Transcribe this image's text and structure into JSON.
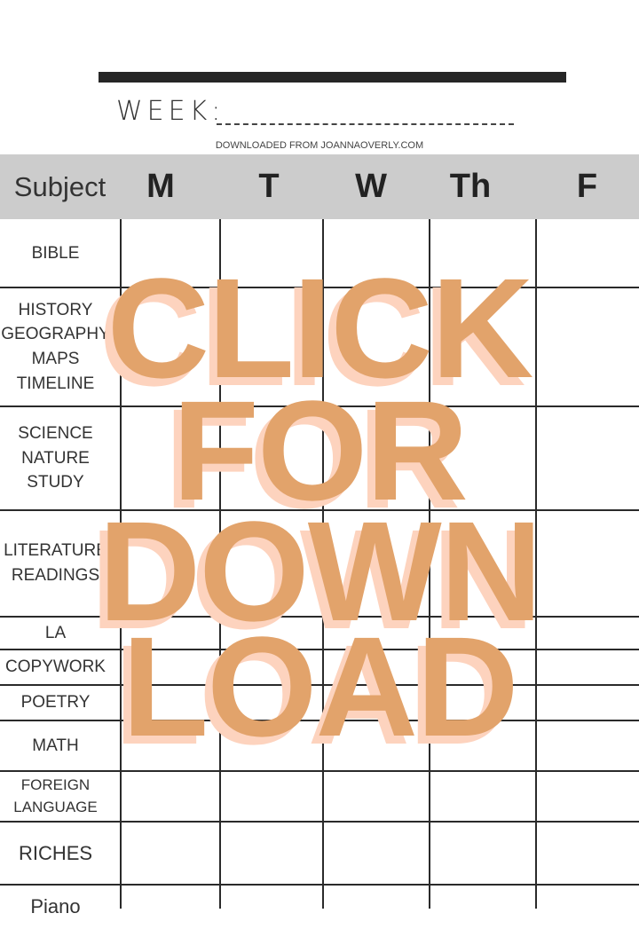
{
  "header": {
    "week_label": "WEEK:",
    "credit": "DOWNLOADED FROM JOANNAOVERLY.COM"
  },
  "table": {
    "columns": [
      "Subject",
      "M",
      "T",
      "W",
      "Th",
      "F"
    ],
    "rows": [
      {
        "label": [
          "BIBLE"
        ]
      },
      {
        "label": [
          "HISTORY",
          "GEOGRAPHY",
          "MAPS",
          "TIMELINE"
        ]
      },
      {
        "label": [
          "SCIENCE",
          "NATURE",
          "STUDY"
        ]
      },
      {
        "label": [
          "LITERATURE",
          "READINGS"
        ]
      },
      {
        "label": [
          "LA"
        ]
      },
      {
        "label": [
          "COPYWORK"
        ]
      },
      {
        "label": [
          "POETRY"
        ]
      },
      {
        "label": [
          "MATH"
        ]
      },
      {
        "label": [
          "FOREIGN",
          "LANGUAGE"
        ]
      },
      {
        "label": [
          "RICHES"
        ]
      },
      {
        "label": [
          "Piano"
        ]
      }
    ]
  },
  "overlay": {
    "lines": [
      "CLICK",
      "FOR",
      "DOWN",
      "LOAD"
    ],
    "color": "#E2A36B",
    "shadow_color": "#FDD3BE"
  }
}
